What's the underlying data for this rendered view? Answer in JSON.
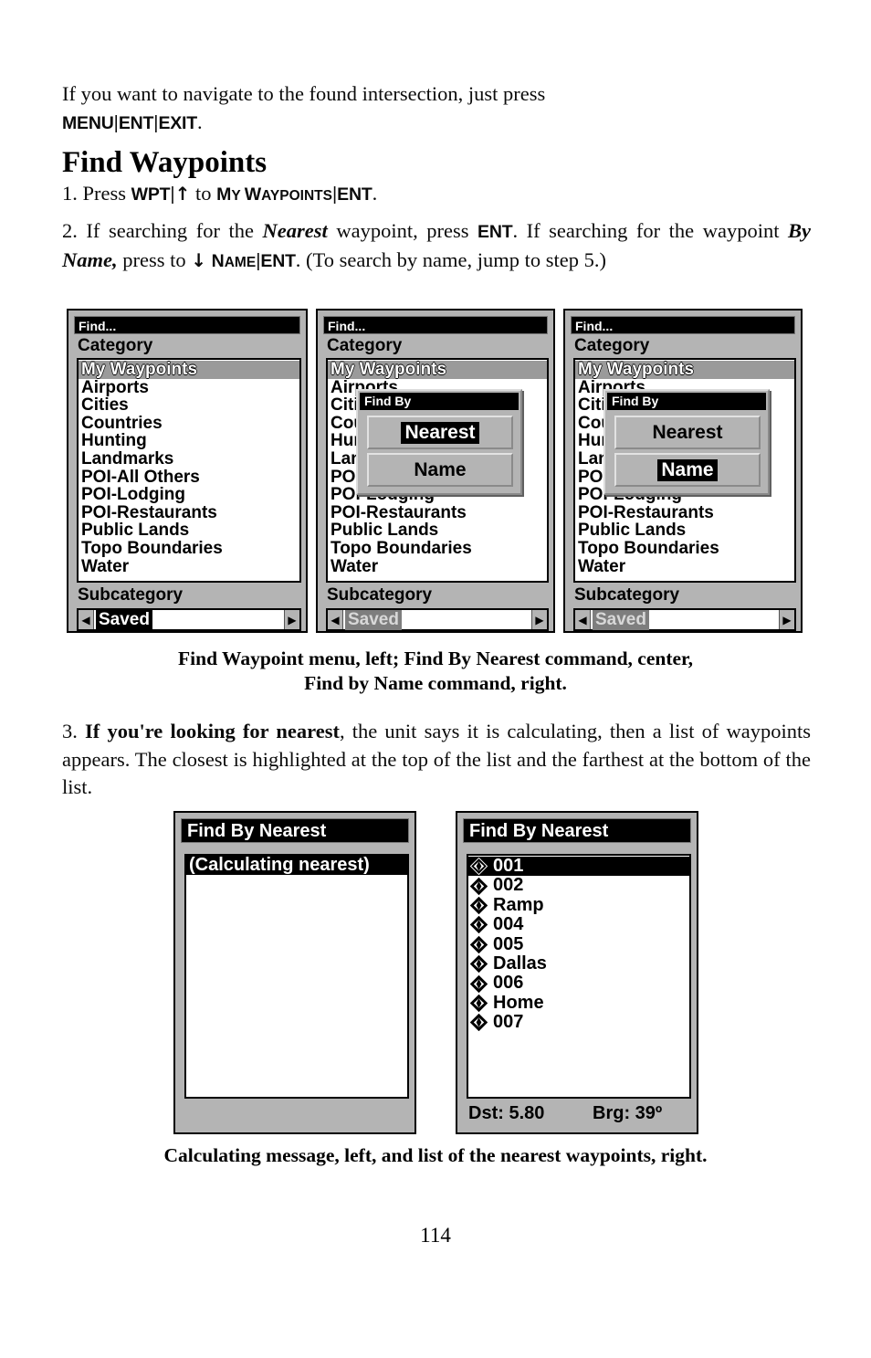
{
  "intro": {
    "line_prefix": "If you want to navigate to the found intersection, just press",
    "keys": [
      "MENU",
      "ENT",
      "EXIT"
    ],
    "trailing": "."
  },
  "heading": "Find Waypoints",
  "step1": {
    "number": "1.",
    "press_word": "Press",
    "key_wpt": "WPT",
    "up_arrow": "↑",
    "to_word": "to",
    "target_caps": "M",
    "target_rest": "Y ",
    "target2_caps": "W",
    "target2_rest": "AYPOINTS",
    "key_ent": "ENT",
    "period": "."
  },
  "step2": {
    "text_a": "2. If searching for the ",
    "em_nearest": "Nearest",
    "text_b": " waypoint, press ",
    "key_ent1": "ENT",
    "text_c": ". If searching for the waypoint ",
    "em_byname": "By Name,",
    "text_d": " press to ",
    "down_arrow": "↓",
    "name_caps": "N",
    "name_rest": "AME",
    "key_ent2": "ENT",
    "text_e": ". (To search by name, jump to step 5.)"
  },
  "step3": {
    "number": "3. ",
    "bold": "If you're looking for nearest",
    "rest": ", the unit says it is calculating, then a list of waypoints appears. The closest is highlighted at the top of the list and the farthest at the bottom of the list."
  },
  "figure1": {
    "caption_line1": "Find Waypoint menu, left; Find By Nearest command, center,",
    "caption_line2": "Find by Name command, right.",
    "panels": [
      {
        "title": "Find...",
        "category_label": "Category",
        "subcategory_label": "Subcategory",
        "subcategory_value": "Saved",
        "left_arrow": "◀",
        "right_arrow": "▶",
        "items": [
          "My Waypoints",
          "Airports",
          "Cities",
          "Countries",
          "Hunting",
          "Landmarks",
          "POI-All Others",
          "POI-Lodging",
          "POI-Restaurants",
          "Public Lands",
          "Topo Boundaries",
          "Water"
        ],
        "selected_index": 0,
        "dialog": null
      },
      {
        "title": "Find...",
        "category_label": "Category",
        "subcategory_label": "Subcategory",
        "subcategory_value": "Saved",
        "left_arrow": "◀",
        "right_arrow": "▶",
        "items": [
          "My Waypoints",
          "Airports",
          "Cities",
          "Countries",
          "Hunting",
          "Landmarks",
          "POI-All Others",
          "POI-Lodging",
          "POI-Restaurants",
          "Public Lands",
          "Topo Boundaries",
          "Water"
        ],
        "selected_index": 0,
        "dialog": {
          "title": "Find By",
          "buttons": [
            "Nearest",
            "Name"
          ],
          "highlighted": "Nearest"
        }
      },
      {
        "title": "Find...",
        "category_label": "Category",
        "subcategory_label": "Subcategory",
        "subcategory_value": "Saved",
        "left_arrow": "◀",
        "right_arrow": "▶",
        "items": [
          "My Waypoints",
          "Airports",
          "Cities",
          "Countries",
          "Hunting",
          "Landmarks",
          "POI-All Others",
          "POI-Lodging",
          "POI-Restaurants",
          "Public Lands",
          "Topo Boundaries",
          "Water"
        ],
        "selected_index": 0,
        "dialog": {
          "title": "Find By",
          "buttons": [
            "Nearest",
            "Name"
          ],
          "highlighted": "Name"
        }
      }
    ]
  },
  "figure2": {
    "caption": "Calculating message, left, and list of the nearest waypoints, right.",
    "left_panel": {
      "title": "Find By Nearest",
      "message": "(Calculating nearest)"
    },
    "right_panel": {
      "title": "Find By Nearest",
      "waypoints": [
        "001",
        "002",
        "Ramp",
        "004",
        "005",
        "Dallas",
        "006",
        "Home",
        "007"
      ],
      "selected_index": 0,
      "distance_label": "Dst: 5.80",
      "bearing_label": "Brg: 39º"
    }
  },
  "page_number": "114",
  "colors": {
    "device_bezel": "#b4b4b4",
    "selection_gray": "#9a9a9a",
    "screen_white": "#ffffff",
    "titlebar_black": "#000000"
  }
}
